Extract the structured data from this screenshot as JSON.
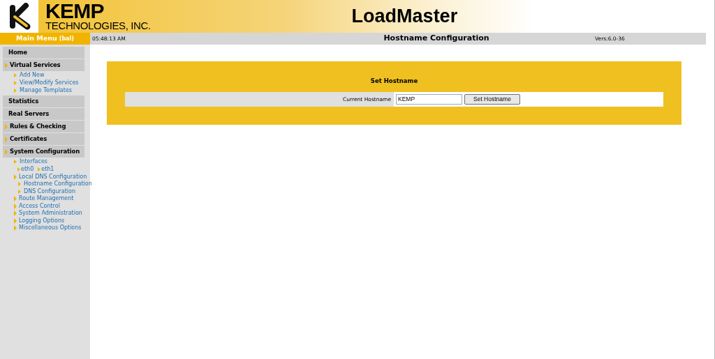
{
  "header": {
    "logo_line1": "KEMP",
    "logo_line2": "TECHNOLOGIES, INC.",
    "title": "LoadMaster"
  },
  "sidebar": {
    "title": "Main Menu",
    "title_suffix": "(bal)",
    "items": [
      {
        "label": "Home",
        "arrow": false
      },
      {
        "label": "Virtual Services",
        "arrow": true,
        "children": [
          {
            "kind": "link",
            "label": "Add New"
          },
          {
            "kind": "link",
            "label": "View/Modify Services"
          },
          {
            "kind": "link",
            "label": "Manage Templates"
          }
        ]
      },
      {
        "label": "Statistics",
        "arrow": false
      },
      {
        "label": "Real Servers",
        "arrow": false
      },
      {
        "label": "Rules & Checking",
        "arrow": true
      },
      {
        "label": "Certificates",
        "arrow": true
      },
      {
        "label": "System Configuration",
        "arrow": true,
        "children": [
          {
            "kind": "link",
            "label": "Interfaces"
          },
          {
            "kind": "inline",
            "children": [
              {
                "label": "eth0"
              },
              {
                "label": "eth1"
              }
            ]
          },
          {
            "kind": "group",
            "label": "Local DNS Configuration",
            "children": [
              {
                "kind": "link",
                "label": "Hostname Configuration"
              },
              {
                "kind": "link",
                "label": "DNS Configuration"
              }
            ]
          },
          {
            "kind": "group",
            "label": "Route Management"
          },
          {
            "kind": "group",
            "label": "Access Control"
          },
          {
            "kind": "group",
            "label": "System Administration"
          },
          {
            "kind": "group",
            "label": "Logging Options"
          },
          {
            "kind": "group",
            "label": "Miscellaneous Options"
          }
        ]
      }
    ]
  },
  "status_bar": {
    "time": "05:48:13 AM",
    "title": "Hostname Configuration",
    "version": "Vers:6.0-36"
  },
  "panel": {
    "heading": "Set Hostname",
    "field_label": "Current Hostname",
    "value": "KEMP",
    "button": "Set Hostname"
  }
}
